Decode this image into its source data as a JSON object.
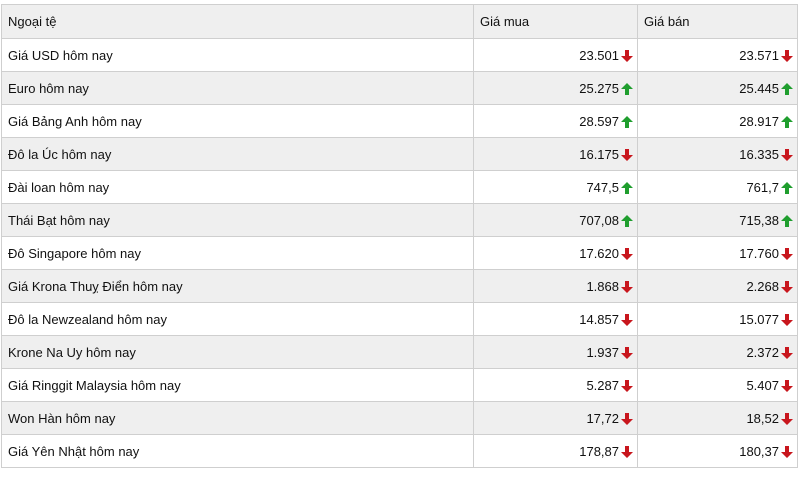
{
  "table": {
    "headers": [
      "Ngoại tệ",
      "Giá mua",
      "Giá bán"
    ],
    "rows": [
      {
        "name": "Giá USD hôm nay",
        "buy": "23.501",
        "buy_trend": "down",
        "sell": "23.571",
        "sell_trend": "down"
      },
      {
        "name": "Euro hôm nay",
        "buy": "25.275",
        "buy_trend": "up",
        "sell": "25.445",
        "sell_trend": "up"
      },
      {
        "name": "Giá Bảng Anh hôm nay",
        "buy": "28.597",
        "buy_trend": "up",
        "sell": "28.917",
        "sell_trend": "up"
      },
      {
        "name": "Đô la Úc hôm nay",
        "buy": "16.175",
        "buy_trend": "down",
        "sell": "16.335",
        "sell_trend": "down"
      },
      {
        "name": "Đài loan hôm nay",
        "buy": "747,5",
        "buy_trend": "up",
        "sell": "761,7",
        "sell_trend": "up"
      },
      {
        "name": "Thái Bạt hôm nay",
        "buy": "707,08",
        "buy_trend": "up",
        "sell": "715,38",
        "sell_trend": "up"
      },
      {
        "name": "Đô Singapore hôm nay",
        "buy": "17.620",
        "buy_trend": "down",
        "sell": "17.760",
        "sell_trend": "down"
      },
      {
        "name": "Giá Krona Thuỵ Điển hôm nay",
        "buy": "1.868",
        "buy_trend": "down",
        "sell": "2.268",
        "sell_trend": "down"
      },
      {
        "name": "Đô la Newzealand hôm nay",
        "buy": "14.857",
        "buy_trend": "down",
        "sell": "15.077",
        "sell_trend": "down"
      },
      {
        "name": "Krone Na Uy hôm nay",
        "buy": "1.937",
        "buy_trend": "down",
        "sell": "2.372",
        "sell_trend": "down"
      },
      {
        "name": "Giá Ringgit Malaysia hôm nay",
        "buy": "5.287",
        "buy_trend": "down",
        "sell": "5.407",
        "sell_trend": "down"
      },
      {
        "name": "Won Hàn hôm nay",
        "buy": "17,72",
        "buy_trend": "down",
        "sell": "18,52",
        "sell_trend": "down"
      },
      {
        "name": "Giá Yên Nhật hôm nay",
        "buy": "178,87",
        "buy_trend": "down",
        "sell": "180,37",
        "sell_trend": "down"
      }
    ]
  },
  "colors": {
    "up": "#1f9e2e",
    "down": "#c8161d"
  },
  "icons": {
    "up": "arrow-up-icon",
    "down": "arrow-down-icon"
  }
}
